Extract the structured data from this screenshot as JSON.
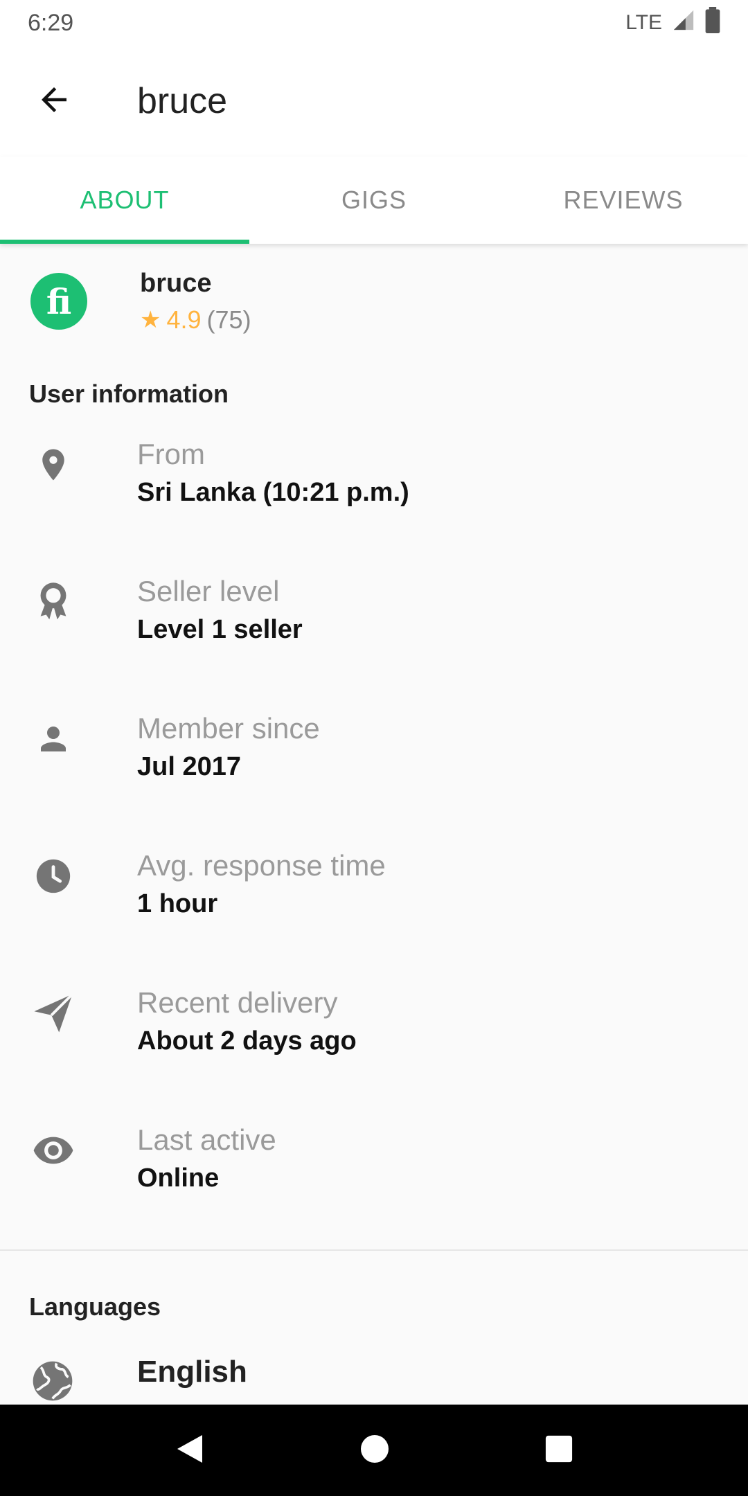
{
  "status_bar": {
    "time": "6:29",
    "network": "LTE"
  },
  "app_bar": {
    "title": "bruce"
  },
  "tabs": [
    {
      "label": "ABOUT",
      "active": true
    },
    {
      "label": "GIGS",
      "active": false
    },
    {
      "label": "REVIEWS",
      "active": false
    }
  ],
  "profile": {
    "name": "bruce",
    "rating": "4.9",
    "review_count": "(75)",
    "logo_text": "fi"
  },
  "user_info": {
    "heading": "User information",
    "rows": [
      {
        "icon": "location-pin-icon",
        "label": "From",
        "value": "Sri Lanka (10:21 p.m.)"
      },
      {
        "icon": "award-ribbon-icon",
        "label": "Seller level",
        "value": "Level 1 seller"
      },
      {
        "icon": "person-icon",
        "label": "Member since",
        "value": "Jul 2017"
      },
      {
        "icon": "clock-icon",
        "label": "Avg. response time",
        "value": "1 hour"
      },
      {
        "icon": "paper-plane-icon",
        "label": "Recent delivery",
        "value": "About 2 days ago"
      },
      {
        "icon": "eye-icon",
        "label": "Last active",
        "value": "Online"
      }
    ]
  },
  "languages": {
    "heading": "Languages",
    "items": [
      {
        "icon": "globe-icon",
        "name": "English"
      }
    ]
  },
  "colors": {
    "accent": "#1dbf73",
    "star": "#ffb33e",
    "muted": "#8a8a8a",
    "icon": "#757575"
  }
}
